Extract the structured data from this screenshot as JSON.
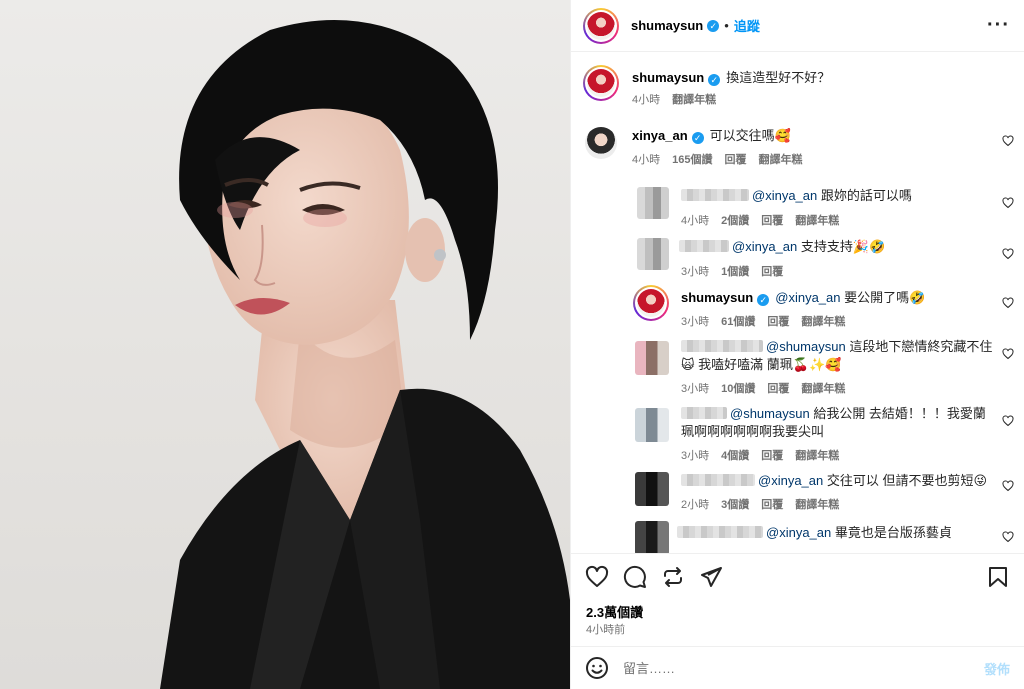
{
  "header": {
    "username": "shumaysun",
    "verified_mark": "✓",
    "separator": "•",
    "follow_label": "追蹤",
    "more_label": "···"
  },
  "caption": {
    "username": "shumaysun",
    "text": "換這造型好不好？",
    "time": "4小時",
    "translate": "翻譯年糕"
  },
  "comments": [
    {
      "user": "xinya_an",
      "mention": "",
      "text": "可以交往嗎🥰",
      "time": "4小時",
      "likes": "165個讚",
      "reply": "回覆",
      "translate": "翻譯年糕"
    },
    {
      "user": "",
      "mention": "@xinya_an",
      "text": "跟妳的話可以嗎",
      "time": "4小時",
      "likes": "2個讚",
      "reply": "回覆",
      "translate": "翻譯年糕"
    },
    {
      "user": "",
      "mention": "@xinya_an",
      "text": "支持支持🎉🤣",
      "time": "3小時",
      "likes": "1個讚",
      "reply": "回覆",
      "translate": ""
    },
    {
      "user": "shumaysun",
      "mention": "@xinya_an",
      "text": "要公開了嗎🤣",
      "time": "3小時",
      "likes": "61個讚",
      "reply": "回覆",
      "translate": "翻譯年糕"
    },
    {
      "user": "",
      "mention": "@shumaysun",
      "text": "這段地下戀情終究藏不住",
      "text2": "🙀 我嗑好嗑滿 蘭珮🍒✨🥰",
      "time": "3小時",
      "likes": "10個讚",
      "reply": "回覆",
      "translate": "翻譯年糕"
    },
    {
      "user": "",
      "mention": "@shumaysun",
      "text": "給我公開 去結婚！！！我愛蘭",
      "text2": "珮啊啊啊啊啊啊我要尖叫",
      "time": "3小時",
      "likes": "4個讚",
      "reply": "回覆",
      "translate": "翻譯年糕"
    },
    {
      "user": "",
      "mention": "@xinya_an",
      "text": "交往可以 但請不要也剪短😜",
      "time": "2小時",
      "likes": "3個讚",
      "reply": "回覆",
      "translate": "翻譯年糕"
    },
    {
      "user": "",
      "mention": "@xinya_an",
      "text": "畢竟也是台版孫藝貞",
      "time": "",
      "likes": "",
      "reply": "",
      "translate": ""
    }
  ],
  "stats": {
    "likes": "2.3萬個讚",
    "time": "4小時前"
  },
  "composer": {
    "placeholder": "留言……",
    "post_label": "發佈"
  },
  "colors": {
    "accent": "#0095f6",
    "verified": "#1a9cf0",
    "mention": "#00376b",
    "post_disabled": "#b2dffc"
  }
}
